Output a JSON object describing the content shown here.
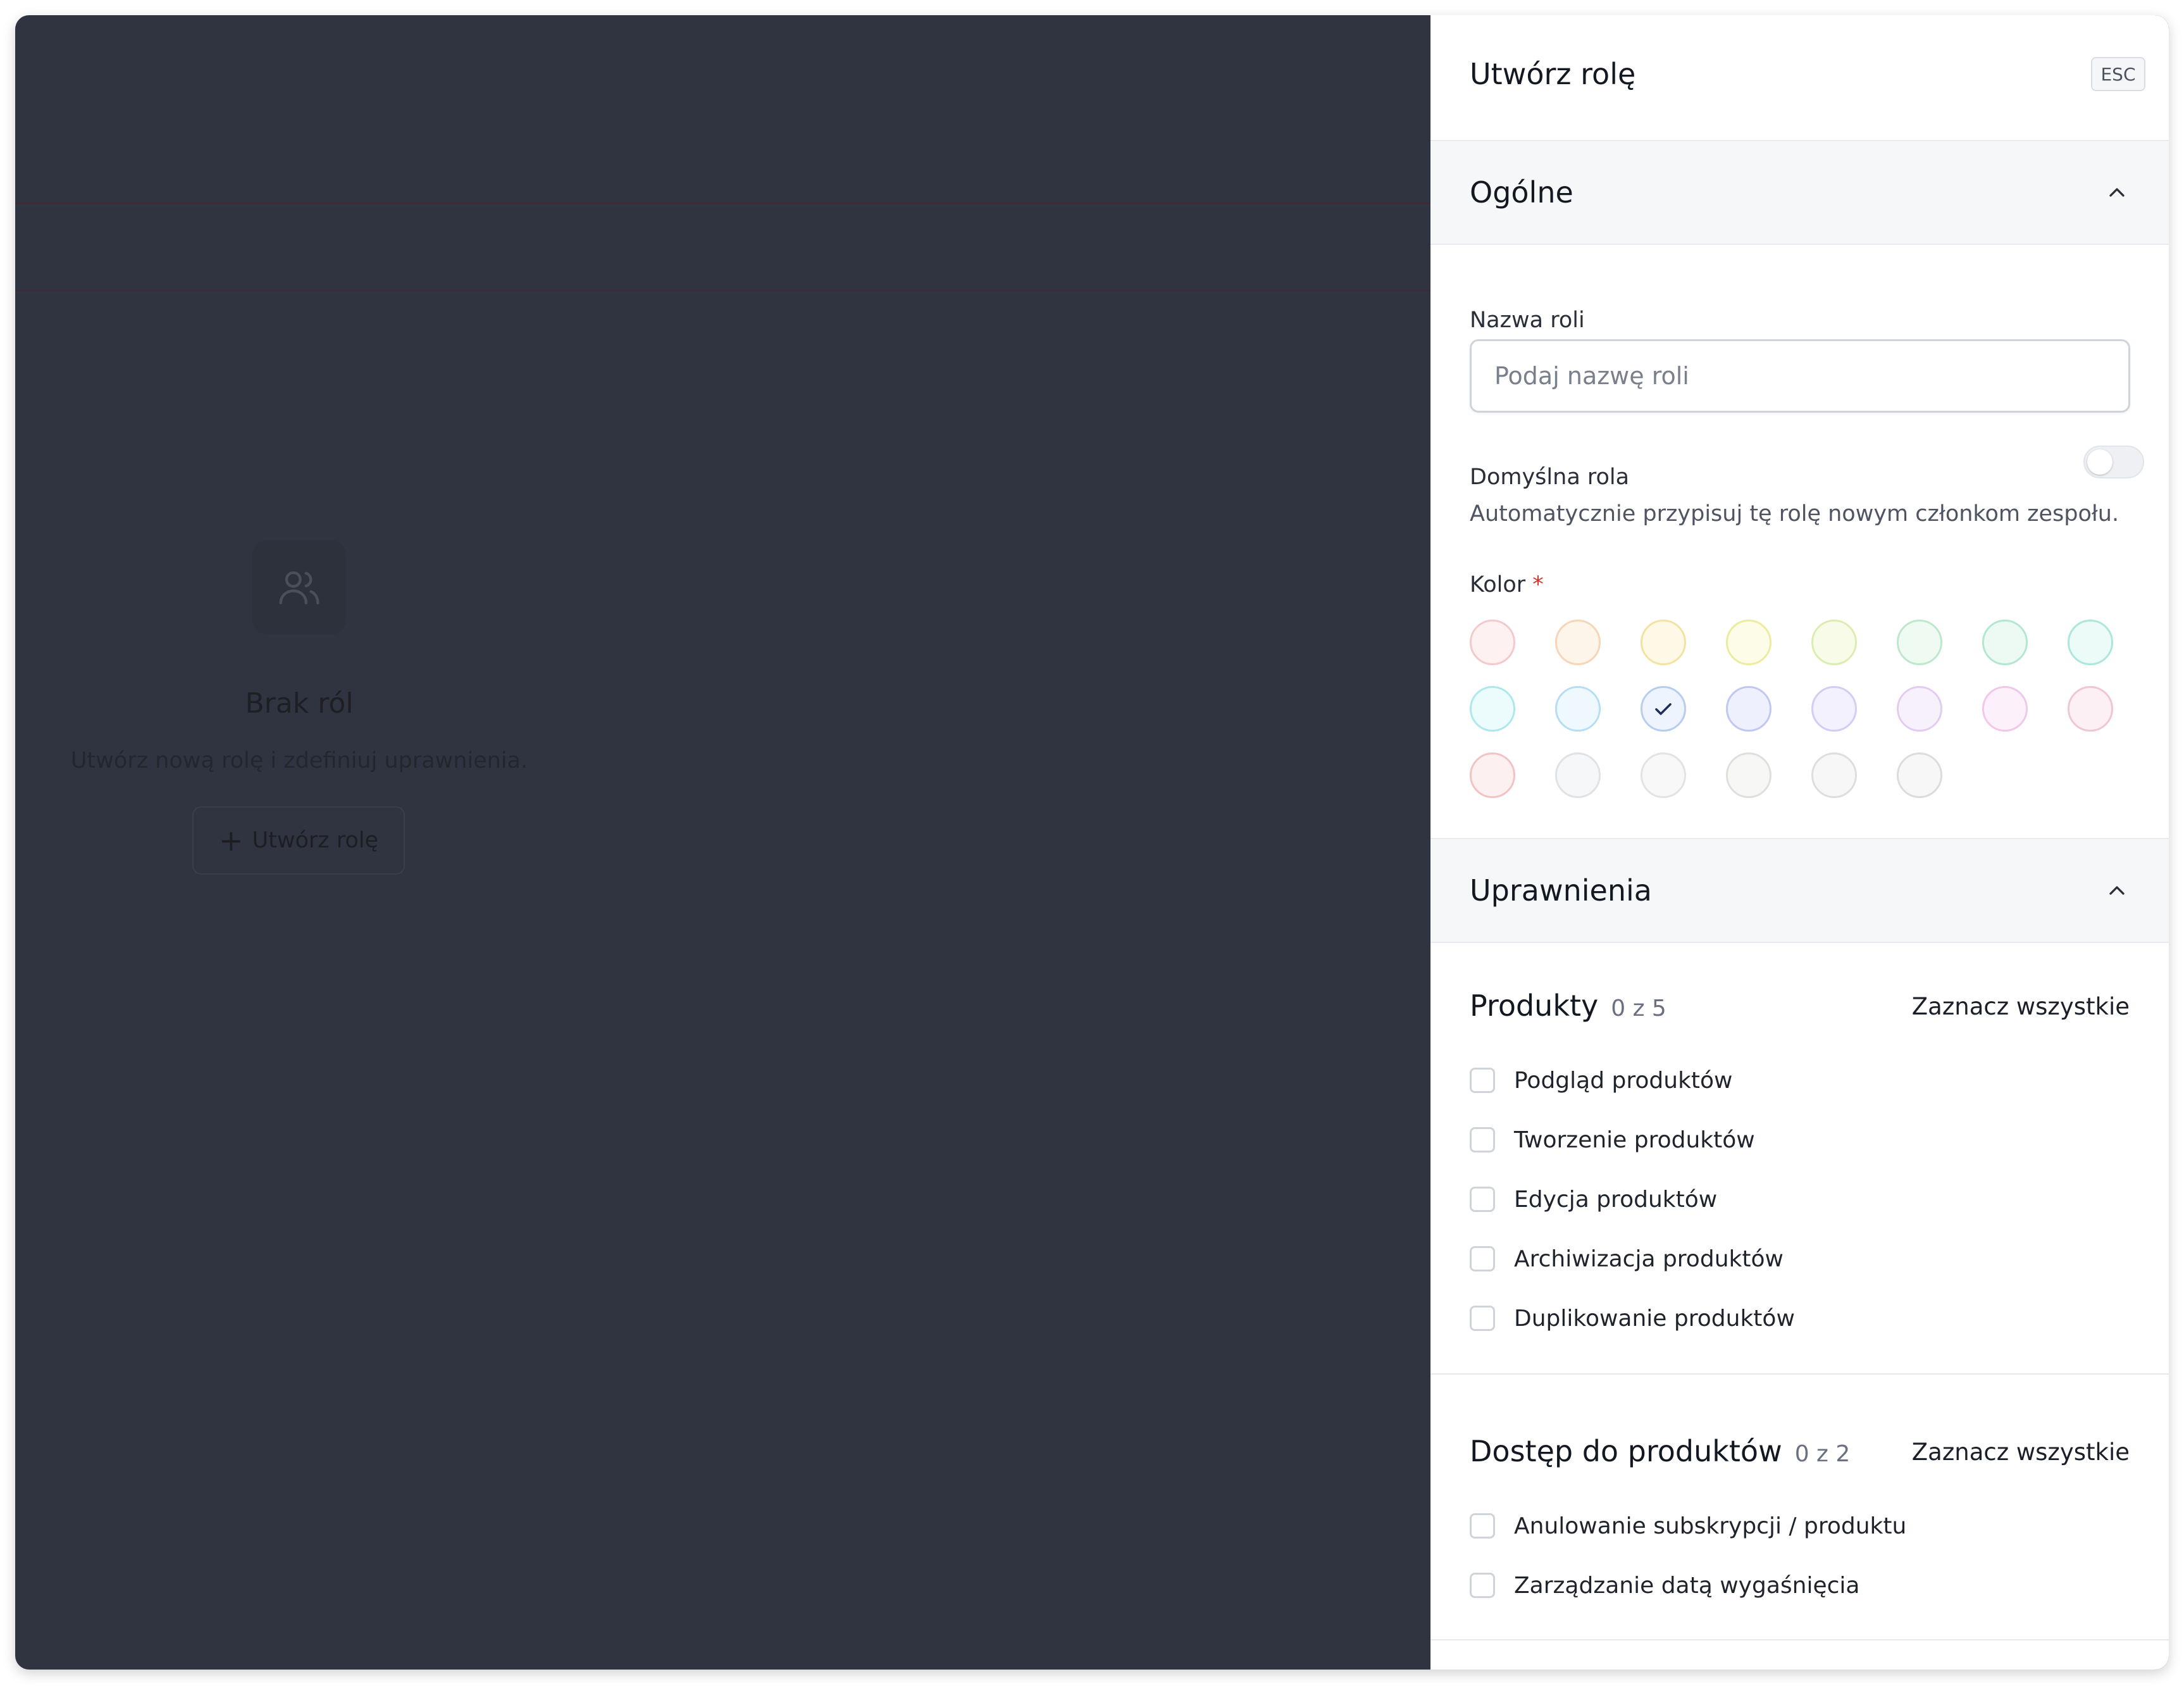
{
  "background": {
    "empty_state": {
      "icon": "users-icon",
      "title": "Brak ról",
      "description": "Utwórz nową rolę i zdefiniuj uprawnienia.",
      "create_button": "Utwórz rolę"
    }
  },
  "panel": {
    "title": "Utwórz rolę",
    "esc_label": "ESC",
    "general": {
      "title": "Ogólne",
      "name_label": "Nazwa roli",
      "name_value": "",
      "name_placeholder": "Podaj nazwę roli",
      "default_label": "Domyślna rola",
      "default_enabled": false,
      "default_help": "Automatycznie przypisuj tę rolę nowym członkom zespołu.",
      "color_label": "Kolor",
      "color_required_mark": "*",
      "selected_color_index": 10,
      "colors": [
        {
          "fill": "#fdf1f1",
          "border": "#f5c9cb"
        },
        {
          "fill": "#fdf4ea",
          "border": "#f5d6b6"
        },
        {
          "fill": "#fdf9e6",
          "border": "#f3e2a2"
        },
        {
          "fill": "#fcfce8",
          "border": "#ecec9e"
        },
        {
          "fill": "#f7fbe8",
          "border": "#dcedb0"
        },
        {
          "fill": "#effaf2",
          "border": "#bfe7cc"
        },
        {
          "fill": "#edfaf4",
          "border": "#b3e7d0"
        },
        {
          "fill": "#ecfbf8",
          "border": "#ace6dc"
        },
        {
          "fill": "#ecfcfc",
          "border": "#aee7ec"
        },
        {
          "fill": "#eef8fd",
          "border": "#b7def2"
        },
        {
          "fill": "#eef4fd",
          "border": "#b6cdee"
        },
        {
          "fill": "#eef0fd",
          "border": "#c0c7f2"
        },
        {
          "fill": "#f3f1fd",
          "border": "#d2cdf3"
        },
        {
          "fill": "#f7f1fc",
          "border": "#e2cdf1"
        },
        {
          "fill": "#fcf0fa",
          "border": "#efc8ea"
        },
        {
          "fill": "#fcf0f4",
          "border": "#f0c6d5"
        },
        {
          "fill": "#fdf0f0",
          "border": "#f3c2c4"
        },
        {
          "fill": "#f6f7f8",
          "border": "#dfe2e6"
        },
        {
          "fill": "#f8f8f8",
          "border": "#e3e3e3"
        },
        {
          "fill": "#f7f7f6",
          "border": "#e0dfdc"
        },
        {
          "fill": "#f7f7f7",
          "border": "#dedede"
        },
        {
          "fill": "#f7f7f7",
          "border": "#dcdcdc"
        }
      ]
    },
    "permissions": {
      "title": "Uprawnienia",
      "select_all_label": "Zaznacz wszystkie",
      "groups": [
        {
          "title": "Produkty",
          "count": "0 z 5",
          "items": [
            "Podgląd produktów",
            "Tworzenie produktów",
            "Edycja produktów",
            "Archiwizacja produktów",
            "Duplikowanie produktów"
          ]
        },
        {
          "title": "Dostęp do produktów",
          "count": "0 z 2",
          "items": [
            "Anulowanie subskrypcji / produktu",
            "Zarządzanie datą wygaśnięcia"
          ]
        }
      ]
    },
    "icons": {
      "collapse": "chevron-up-icon",
      "check": "check-icon"
    }
  }
}
